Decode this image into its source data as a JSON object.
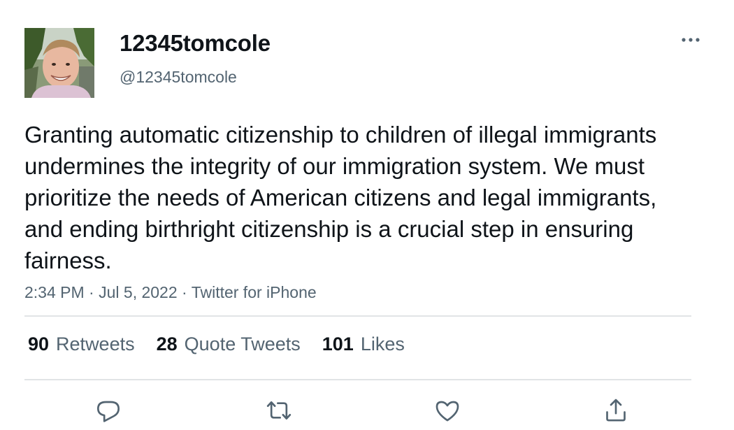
{
  "tweet": {
    "author": {
      "display_name": "12345tomcole",
      "handle": "@12345tomcole"
    },
    "text": "Granting automatic citizenship to children of illegal immigrants undermines the integrity of our immigration system. We must prioritize the needs of American citizens and legal immigrants, and ending birthright citizenship is a crucial step in ensuring fairness.",
    "time": "2:34 PM",
    "separator": "·",
    "date": "Jul 5, 2022",
    "source": "Twitter for iPhone"
  },
  "stats": {
    "retweets": {
      "count": "90",
      "label": "Retweets"
    },
    "quotes": {
      "count": "28",
      "label": "Quote Tweets"
    },
    "likes": {
      "count": "101",
      "label": "Likes"
    }
  },
  "icons": {
    "more": "more-horizontal-icon",
    "reply": "reply-icon",
    "retweet": "retweet-icon",
    "like": "heart-icon",
    "share": "share-icon"
  },
  "colors": {
    "text_primary": "#0f1419",
    "text_secondary": "#536471",
    "divider": "#e1e4e6"
  }
}
